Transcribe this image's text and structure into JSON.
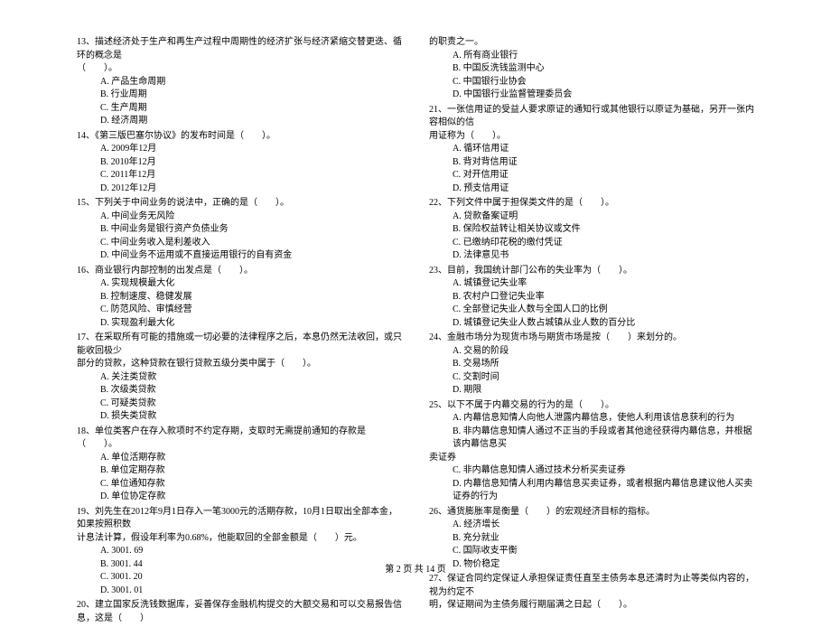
{
  "col_left": [
    {
      "num": "13",
      "text": "、描述经济处于生产和再生产过程中周期性的经济扩张与经济紧缩交替更迭、循环的概念是",
      "cont": "（　　）。",
      "opts": [
        "A. 产品生命周期",
        "B. 行业周期",
        "C. 生产周期",
        "D. 经济周期"
      ]
    },
    {
      "num": "14",
      "text": "、《第三版巴塞尔协议》的发布时间是（　　）。",
      "opts": [
        "A. 2009年12月",
        "B. 2010年12月",
        "C. 2011年12月",
        "D. 2012年12月"
      ]
    },
    {
      "num": "15",
      "text": "、下列关于中间业务的说法中，正确的是（　　）。",
      "opts": [
        "A. 中间业务无风险",
        "B. 中间业务是银行资产负债业务",
        "C. 中间业务收入是利差收入",
        "D. 中间业务不运用或不直接运用银行的自有资金"
      ]
    },
    {
      "num": "16",
      "text": "、商业银行内部控制的出发点是（　　）。",
      "opts": [
        "A. 实现规模最大化",
        "B. 控制速度、稳健发展",
        "C. 防范风险、审慎经营",
        "D. 实现盈利最大化"
      ]
    },
    {
      "num": "17",
      "text": "、在采取所有可能的措施或一切必要的法律程序之后，本息仍然无法收回，或只能收回极少",
      "cont": "部分的贷款，这种贷款在银行贷款五级分类中属于（　　）。",
      "opts": [
        "A. 关注类贷款",
        "B. 次级类贷款",
        "C. 可疑类贷款",
        "D. 损失类贷款"
      ]
    },
    {
      "num": "18",
      "text": "、单位类客户在存入款项时不约定存期，支取时无需提前通知的存款是（　　）。",
      "opts": [
        "A. 单位活期存款",
        "B. 单位定期存款",
        "C. 单位通知存款",
        "D. 单位协定存款"
      ]
    },
    {
      "num": "19",
      "text": "、刘先生在2012年9月1日存入一笔3000元的活期存款，10月1日取出全部本金，如果按照积数",
      "cont": "计息法计算，假设年利率为0.68%，他能取回的全部金额是（　　）元。",
      "opts": [
        "A. 3001. 69",
        "B. 3001. 44",
        "C. 3001. 20",
        "D. 3001. 01"
      ]
    },
    {
      "num": "20",
      "text": "、建立国家反洗钱数据库，妥善保存金融机构提交的大额交易和可以交易报告信息，这是（　　）"
    }
  ],
  "col_right_pre": [
    {
      "cont": "的职责之一。",
      "opts": [
        "A. 所有商业银行",
        "B. 中国反洗钱监测中心",
        "C. 中国银行业协会",
        "D. 中国银行业监督管理委员会"
      ]
    }
  ],
  "col_right": [
    {
      "num": "21",
      "text": "、一张信用证的受益人要求原证的通知行或其他银行以原证为基础，另开一张内容相似的信",
      "cont": "用证称为（　　）。",
      "opts": [
        "A. 循环信用证",
        "B. 背对背信用证",
        "C. 对开信用证",
        "D. 预支信用证"
      ]
    },
    {
      "num": "22",
      "text": "、下列文件中属于担保类文件的是（　　）。",
      "opts": [
        "A. 贷款备案证明",
        "B. 保险权益转让相关协议或文件",
        "C. 已缴纳印花税的缴付凭证",
        "D. 法律意见书"
      ]
    },
    {
      "num": "23",
      "text": "、目前，我国统计部门公布的失业率为（　　）。",
      "opts": [
        "A. 城镇登记失业率",
        "B. 农村户口登记失业率",
        "C. 全部登记失业人数与全国人口的比例",
        "D. 城镇登记失业人数占城镇从业人数的百分比"
      ]
    },
    {
      "num": "24",
      "text": "、金融市场分为现货市场与期货市场是按（　　）来划分的。",
      "opts": [
        "A. 交易的阶段",
        "B. 交易场所",
        "C. 交割时间",
        "D. 期限"
      ]
    },
    {
      "num": "25",
      "text": "、以下不属于内幕交易的行为的是（　　）。",
      "opts_custom": [
        "A. 内幕信息知情人向他人泄露内幕信息，使他人利用该信息获利的行为",
        "B. 非内幕信息知情人通过不正当的手段或者其他途径获得内幕信息，并根据该内幕信息买"
      ],
      "cont2": "卖证券",
      "opts2": [
        "C. 非内幕信息知情人通过技术分析买卖证券",
        "D. 内幕信息知情人利用内幕信息买卖证券，或者根据内幕信息建议他人买卖证券的行为"
      ]
    },
    {
      "num": "26",
      "text": "、通货膨胀率是衡量（　　）的宏观经济目标的指标。",
      "opts": [
        "A. 经济增长",
        "B. 充分就业",
        "C. 国际收支平衡",
        "D. 物价稳定"
      ]
    },
    {
      "num": "27",
      "text": "、保证合同约定保证人承担保证责任直至主债务本息还清时为止等类似内容的，视为约定不",
      "cont": "明，保证期间为主债务履行期届满之日起（　　）。"
    }
  ],
  "footer": "第 2 页 共 14 页"
}
